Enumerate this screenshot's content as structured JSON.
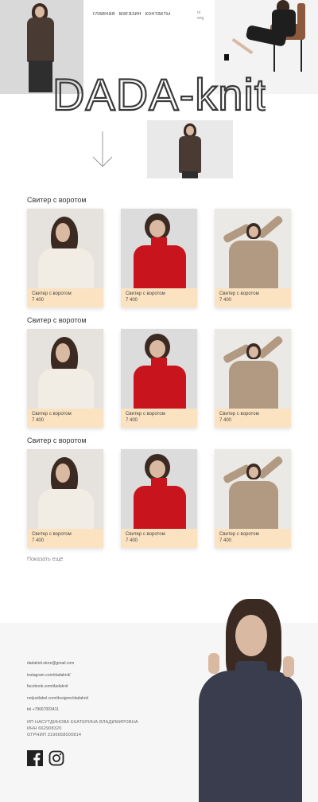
{
  "nav": {
    "items": [
      "главная",
      "магазин",
      "контакты"
    ],
    "lang": [
      "ru",
      "eng"
    ]
  },
  "logo": {
    "text": "DADA-knit"
  },
  "sections": [
    {
      "title": "Свитер с воротом",
      "products": [
        {
          "name": "Свитер с воротом",
          "price": "7 400"
        },
        {
          "name": "Свитер с воротом",
          "price": "7 400"
        },
        {
          "name": "Свитер с воротом",
          "price": "7 400"
        }
      ]
    },
    {
      "title": "Свитер с воротом",
      "products": [
        {
          "name": "Свитер с воротом",
          "price": "7 400"
        },
        {
          "name": "Свитер с воротом",
          "price": "7 400"
        },
        {
          "name": "Свитер с воротом",
          "price": "7 400"
        }
      ]
    },
    {
      "title": "Свитер с воротом",
      "products": [
        {
          "name": "Свитер с воротом",
          "price": "7 400"
        },
        {
          "name": "Свитер с воротом",
          "price": "7 400"
        },
        {
          "name": "Свитер с воротом",
          "price": "7 400"
        }
      ]
    }
  ],
  "show_more": "Показать ещё",
  "footer": {
    "contacts": [
      "dadaknit.store@gmail.com",
      "instagram.com/dadaknit/",
      "facebook.com/dadaknit",
      "notjustlabel.com/designer/dadaknit",
      "tel +79667003411"
    ],
    "legal": [
      "ИП НАСУТДИНОВА ЕКАТЕРИНА ВЛАДИМИРОВНА",
      "ИНН 662908320",
      "ОГРНИП 3196658000814"
    ],
    "social": [
      "facebook-icon",
      "instagram-icon"
    ]
  },
  "colors": {
    "card_info_bg": "#fbe3c2",
    "footer_bg": "#f6f6f6",
    "red_sweater": "#c8141c",
    "cream_sweater": "#f1ece4",
    "beige_sweater": "#b29a82",
    "navy_sweater": "#3a3d4e",
    "brown_sweater": "#4a3a34"
  }
}
